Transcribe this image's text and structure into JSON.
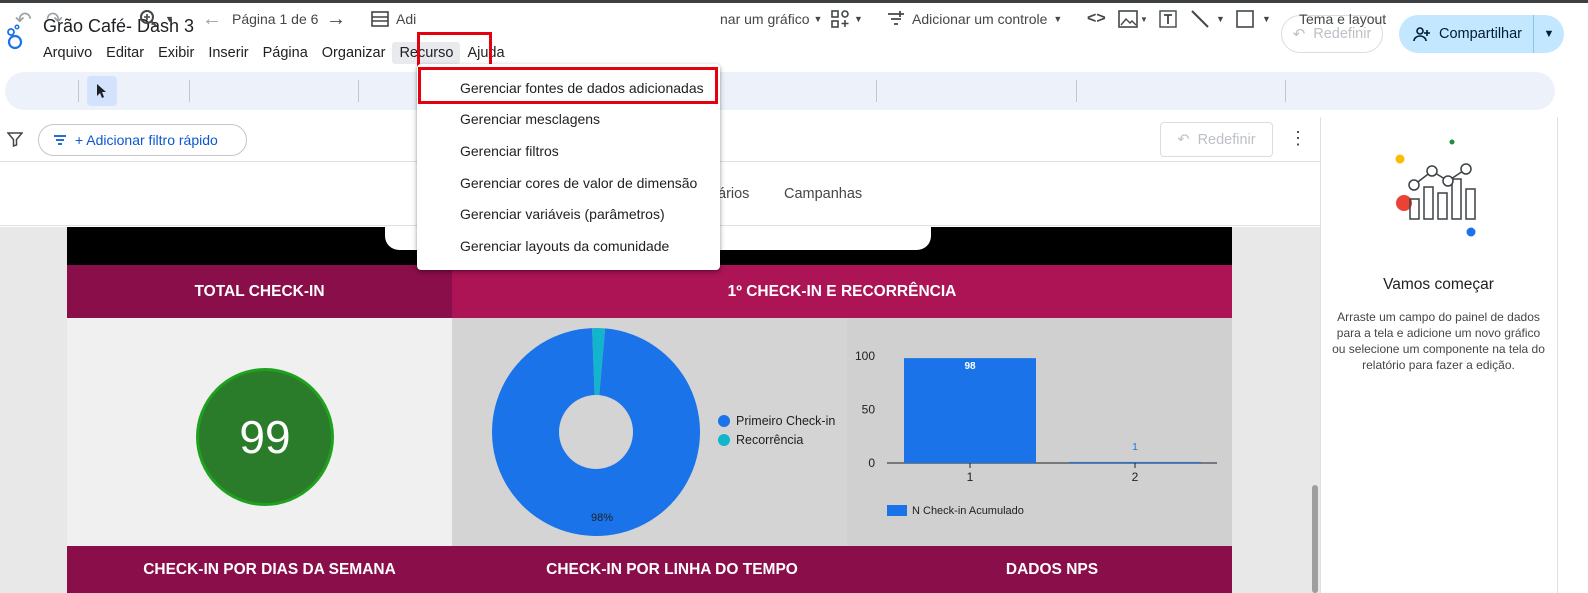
{
  "app": {
    "title": "Grão Café- Dash 3"
  },
  "menubar": [
    "Arquivo",
    "Editar",
    "Exibir",
    "Inserir",
    "Página",
    "Organizar",
    "Recurso",
    "Ajuda"
  ],
  "header": {
    "reset_label": "Redefinir",
    "share_label": "Compartilhar"
  },
  "toolbar": {
    "page_label": "Página 1 de 6",
    "add_data_partial": "Adi",
    "add_chart_partial": "nar um gráfico",
    "add_control": "Adicionar um controle",
    "theme": "Tema e layout"
  },
  "filterbar": {
    "quick_filter": "+ Adicionar filtro rápido",
    "reset_label": "Redefinir"
  },
  "nav": {
    "partial_tab": "ários",
    "tab_campanhas": "Campanhas"
  },
  "resource_menu": {
    "items": [
      "Gerenciar fontes de dados adicionadas",
      "Gerenciar mesclagens",
      "Gerenciar filtros",
      "Gerenciar cores de valor de dimensão",
      "Gerenciar variáveis (parâmetros)",
      "Gerenciar layouts da comunidade"
    ]
  },
  "report": {
    "header_total": "TOTAL CHECK-IN",
    "header_recurrence": "1º CHECK-IN E RECORRÊNCIA",
    "kpi_value": "99",
    "pie_percent": "98%",
    "pie_legend": [
      "Primeiro Check-in",
      "Recorrência"
    ],
    "bar_legend": "N Check-in Acumulado",
    "bottom_headers": [
      "CHECK-IN POR DIAS DA SEMANA",
      "CHECK-IN POR LINHA DO TEMPO",
      "DADOS NPS"
    ]
  },
  "right_panel": {
    "title": "Vamos começar",
    "description": "Arraste um campo do painel de dados para a tela e adicione um novo gráfico ou selecione um componente na tela do relatório para fazer a edição."
  },
  "colors": {
    "accent": "#1a73e8",
    "share_bg": "#c2e7ff",
    "header_dark": "#8a0e4a",
    "header_mid": "#ac1455",
    "kpi_green": "#2a7c2a",
    "highlight_red": "#e3000f"
  },
  "chart_data": [
    {
      "type": "pie",
      "categories": [
        "Primeiro Check-in",
        "Recorrência"
      ],
      "values": [
        98,
        2
      ],
      "colors": [
        "#1a73e8",
        "#12b5cb"
      ],
      "data_labels": [
        "98%"
      ],
      "donut": true
    },
    {
      "type": "bar",
      "categories": [
        "1",
        "2"
      ],
      "series": [
        {
          "name": "N Check-in Acumulado",
          "values": [
            98,
            1
          ]
        }
      ],
      "ylim": [
        0,
        100
      ],
      "yticks": [
        "0",
        "50",
        "100"
      ],
      "data_labels": [
        "98",
        "1"
      ],
      "legend": "bottom-left"
    }
  ]
}
